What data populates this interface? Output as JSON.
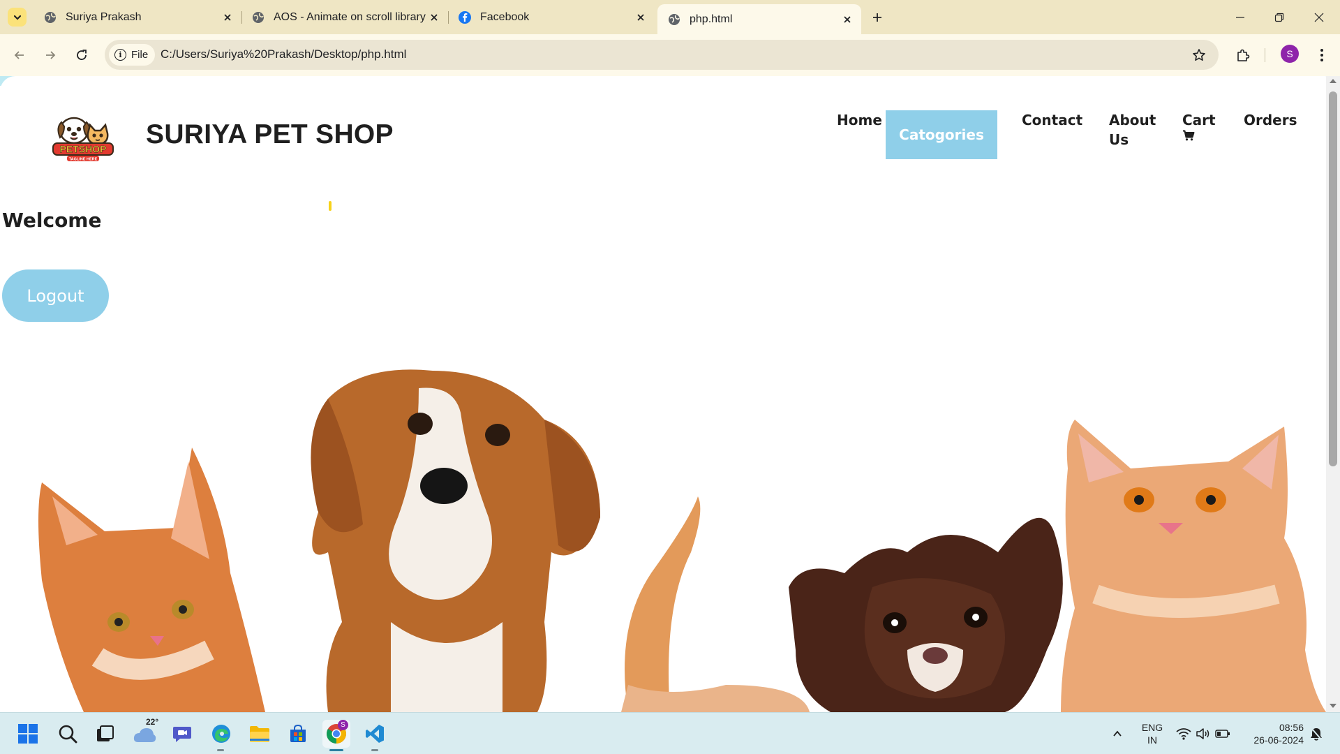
{
  "browser": {
    "tabs": [
      {
        "title": "Suriya Prakash",
        "icon": "globe-icon",
        "active": false
      },
      {
        "title": "AOS - Animate on scroll library",
        "icon": "globe-icon",
        "active": false
      },
      {
        "title": "Facebook",
        "icon": "facebook-icon",
        "active": false
      },
      {
        "title": "php.html",
        "icon": "globe-icon",
        "active": true
      }
    ],
    "site_chip": "File",
    "url": "C:/Users/Suriya%20Prakash/Desktop/php.html",
    "profile_initial": "S",
    "colors": {
      "tabstrip": "#efe6c4",
      "toolbar": "#fdf9ea",
      "profile": "#8e24aa"
    }
  },
  "site": {
    "logo_text": "PETSHOP",
    "logo_tagline": "TAGLINE HERE",
    "brand": "SURIYA PET SHOP",
    "nav": [
      {
        "label": "Home"
      },
      {
        "label": "Catogories",
        "active": true
      },
      {
        "label": "Contact"
      },
      {
        "label": "About Us"
      },
      {
        "label": "Cart"
      },
      {
        "label": "Orders"
      }
    ],
    "welcome": "Welcome",
    "logout_label": "Logout",
    "accent_color": "#8fcfe9"
  },
  "taskbar": {
    "weather_temp": "22°",
    "chrome_badge": "S",
    "lang_line1": "ENG",
    "lang_line2": "IN",
    "time": "08:56",
    "date": "26-06-2024"
  }
}
